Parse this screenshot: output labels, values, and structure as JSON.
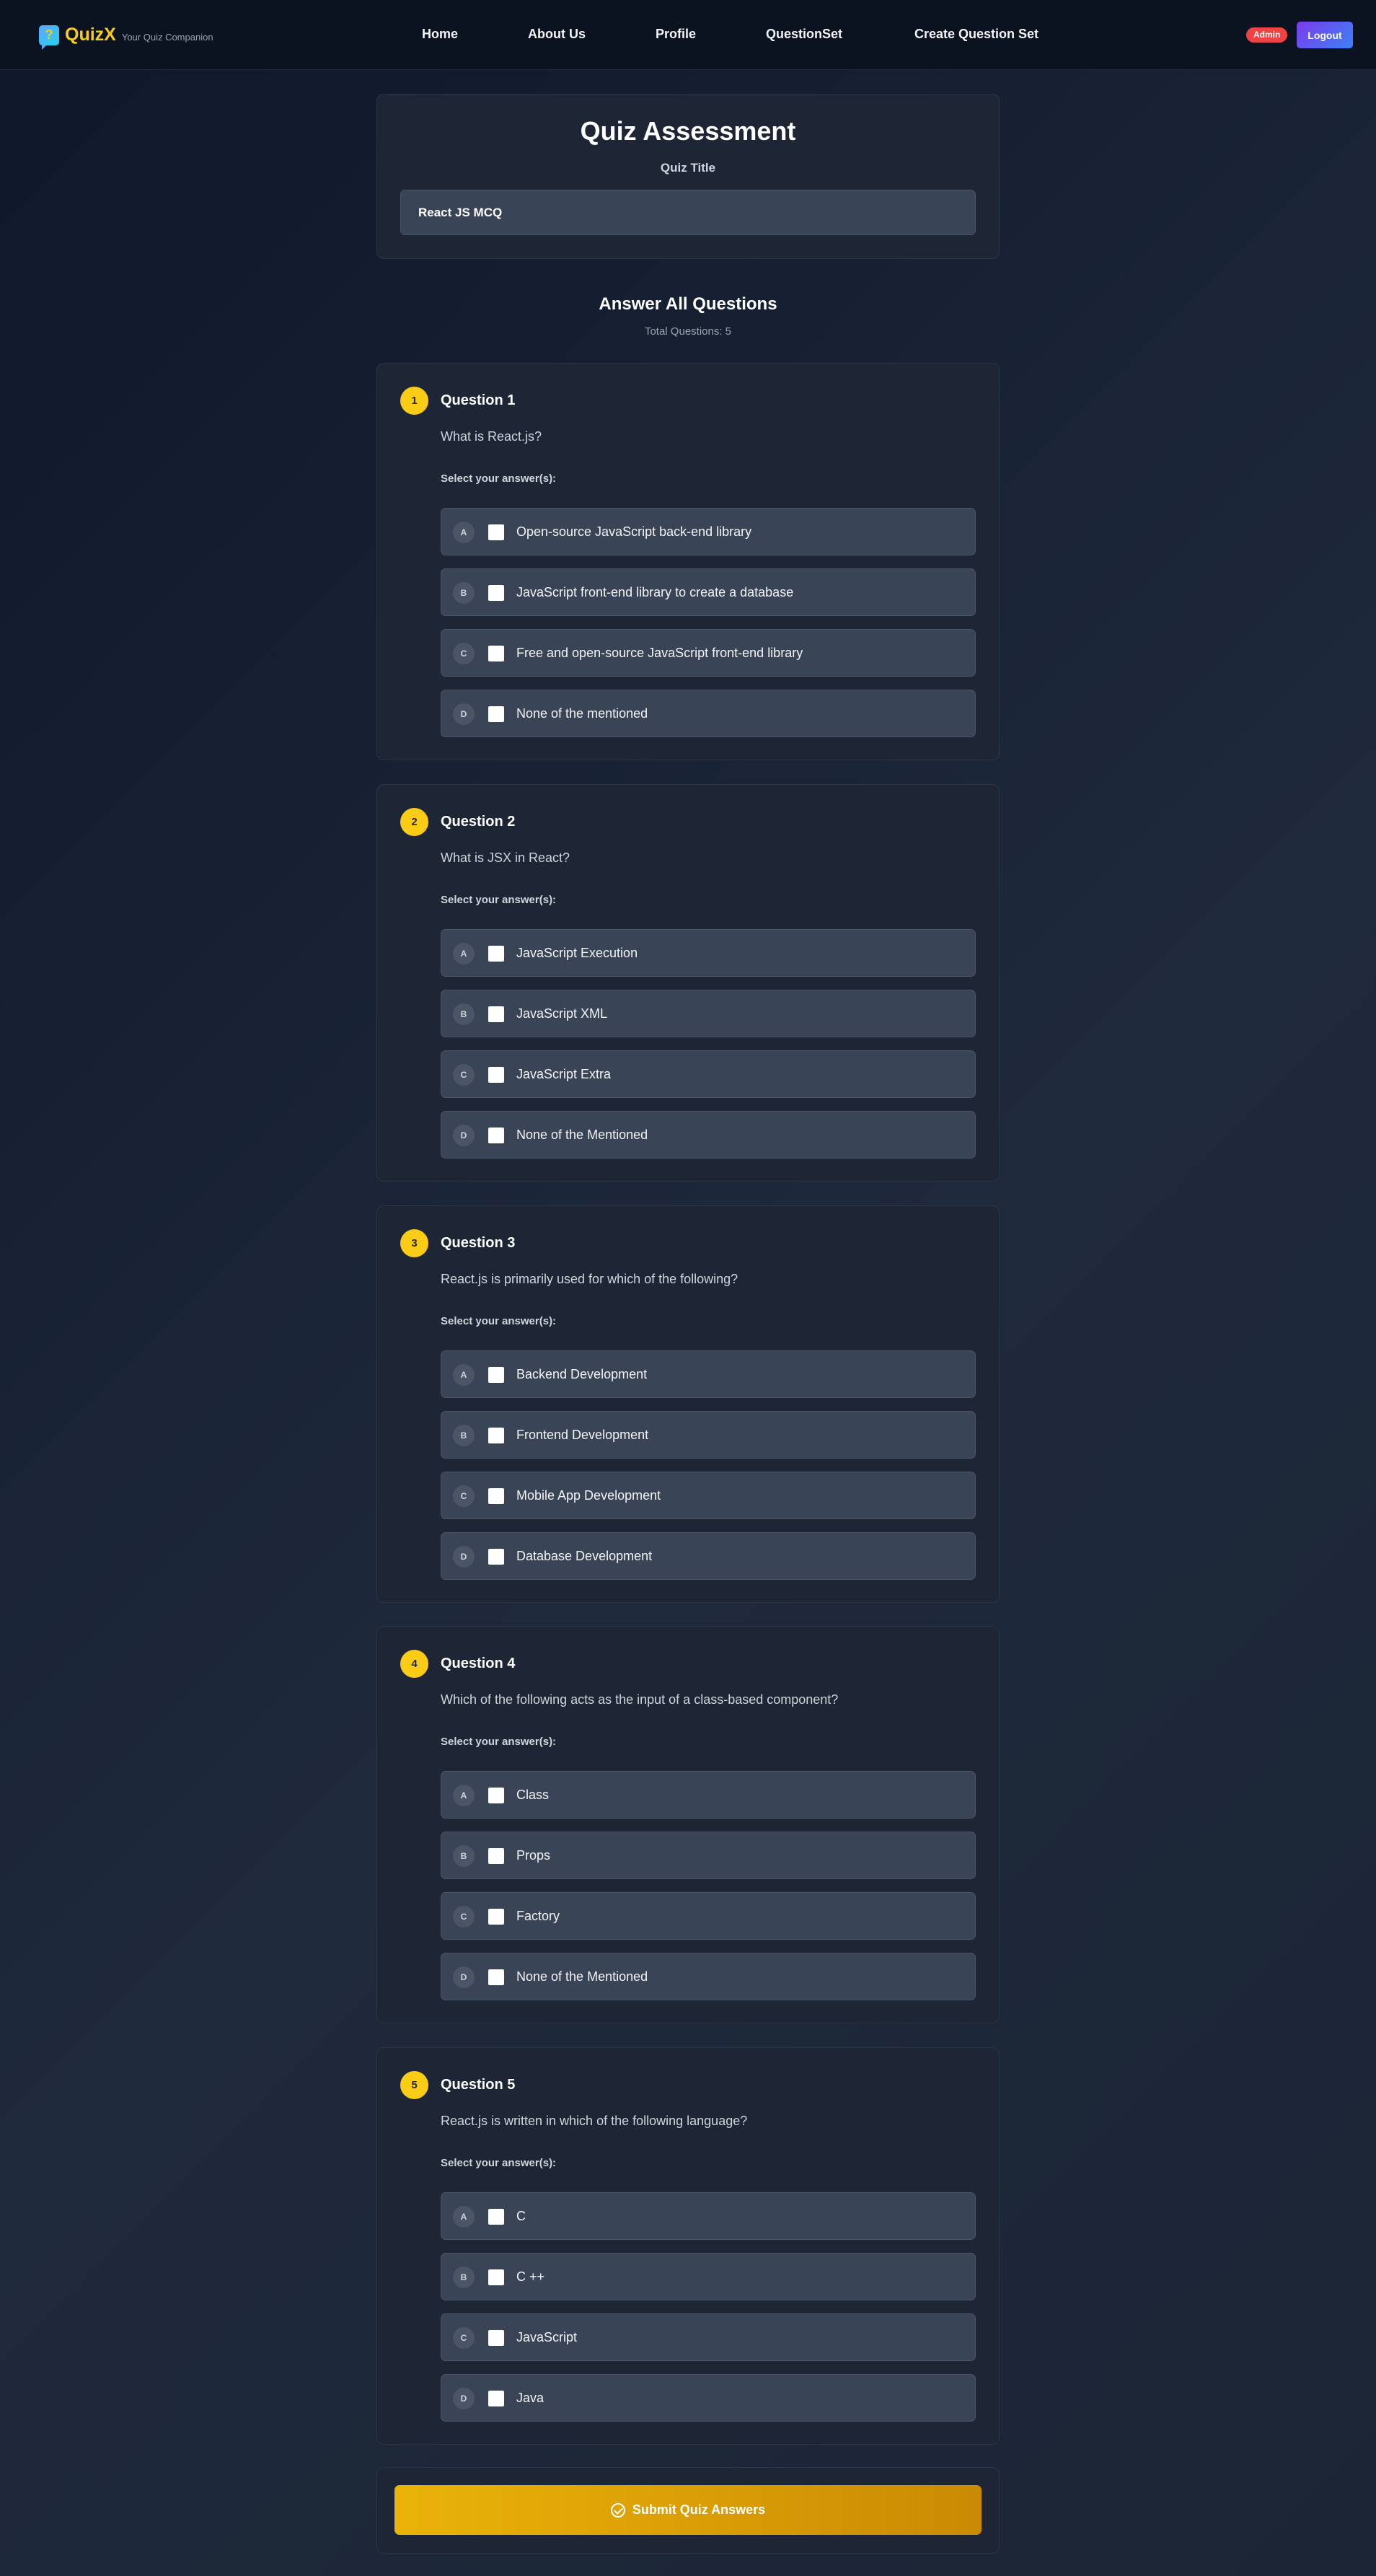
{
  "navbar": {
    "brand_name": "QuizX",
    "brand_tagline": "Your Quiz Companion",
    "links": [
      "Home",
      "About Us",
      "Profile",
      "QuestionSet",
      "Create Question Set"
    ],
    "badge": "Admin",
    "logout_label": "Logout"
  },
  "header": {
    "heading": "Quiz Assessment",
    "title_label": "Quiz Title",
    "title_value": "React JS MCQ"
  },
  "summary": {
    "heading": "Answer All Questions",
    "total": "Total Questions: 5"
  },
  "select_label": "Select your answer(s):",
  "questions": [
    {
      "number": "1",
      "title": "Question 1",
      "text": "What is React.js?",
      "options": [
        {
          "letter": "A",
          "text": "Open-source JavaScript back-end library"
        },
        {
          "letter": "B",
          "text": "JavaScript front-end library to create a database"
        },
        {
          "letter": "C",
          "text": "Free and open-source JavaScript front-end library"
        },
        {
          "letter": "D",
          "text": "None of the mentioned"
        }
      ]
    },
    {
      "number": "2",
      "title": "Question 2",
      "text": "What is JSX in React?",
      "options": [
        {
          "letter": "A",
          "text": "JavaScript Execution"
        },
        {
          "letter": "B",
          "text": "JavaScript XML"
        },
        {
          "letter": "C",
          "text": "JavaScript Extra"
        },
        {
          "letter": "D",
          "text": "None of the Mentioned"
        }
      ]
    },
    {
      "number": "3",
      "title": "Question 3",
      "text": "React.js is primarily used for which of the following?",
      "options": [
        {
          "letter": "A",
          "text": "Backend Development"
        },
        {
          "letter": "B",
          "text": "Frontend Development"
        },
        {
          "letter": "C",
          "text": "Mobile App Development"
        },
        {
          "letter": "D",
          "text": "Database Development"
        }
      ]
    },
    {
      "number": "4",
      "title": "Question 4",
      "text": "Which of the following acts as the input of a class-based component?",
      "options": [
        {
          "letter": "A",
          "text": "Class"
        },
        {
          "letter": "B",
          "text": "Props"
        },
        {
          "letter": "C",
          "text": "Factory"
        },
        {
          "letter": "D",
          "text": "None of the Mentioned"
        }
      ]
    },
    {
      "number": "5",
      "title": "Question 5",
      "text": "React.js is written in which of the following language?",
      "options": [
        {
          "letter": "A",
          "text": "C"
        },
        {
          "letter": "B",
          "text": "C ++"
        },
        {
          "letter": "C",
          "text": "JavaScript"
        },
        {
          "letter": "D",
          "text": "Java"
        }
      ]
    }
  ],
  "submit_label": "Submit Quiz Answers"
}
